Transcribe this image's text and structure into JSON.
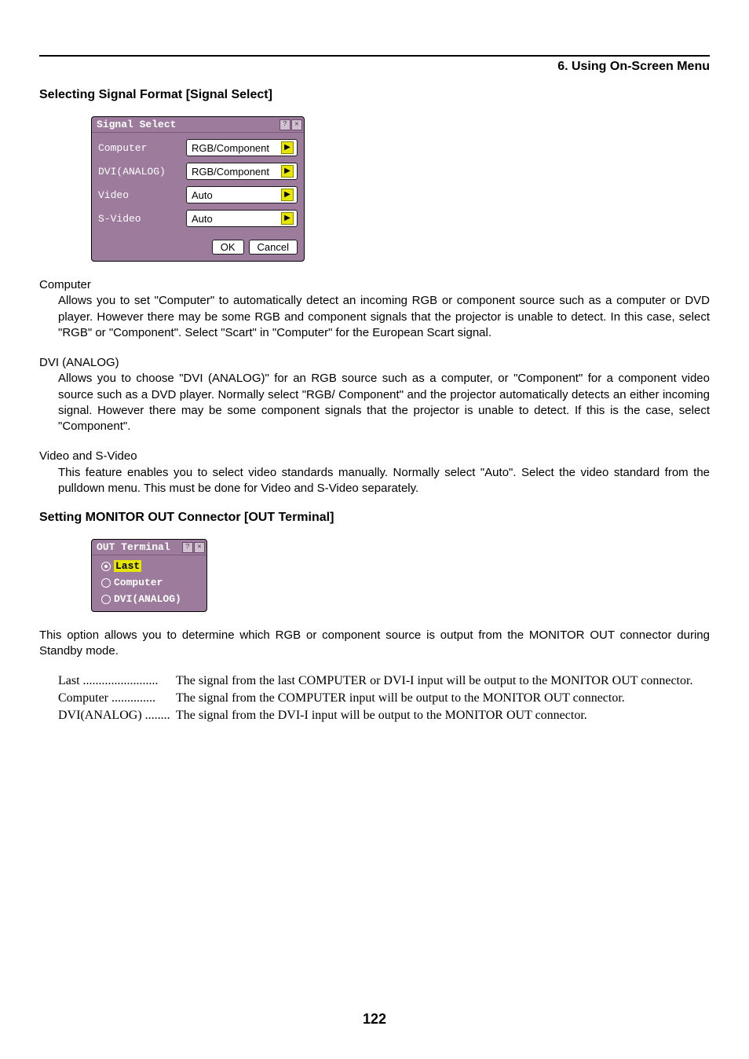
{
  "header": {
    "section_title": "6. Using On-Screen Menu"
  },
  "section1": {
    "heading": "Selecting Signal Format [Signal Select]",
    "dialog": {
      "title": "Signal Select",
      "rows": [
        {
          "label": "Computer",
          "value": "RGB/Component"
        },
        {
          "label": "DVI(ANALOG)",
          "value": "RGB/Component"
        },
        {
          "label": "Video",
          "value": "Auto"
        },
        {
          "label": "S-Video",
          "value": "Auto"
        }
      ],
      "ok": "OK",
      "cancel": "Cancel"
    },
    "computer": {
      "term": "Computer",
      "body": "Allows you to set \"Computer\" to automatically detect an incoming RGB or component source such as a computer or DVD player. However there may be some RGB and component signals that the projector is unable to detect. In this case, select \"RGB\" or \"Component\". Select \"Scart\" in \"Computer\" for the European Scart signal."
    },
    "dvi": {
      "term": "DVI (ANALOG)",
      "body": "Allows you to choose \"DVI (ANALOG)\" for an RGB source such as a computer, or \"Component\" for a component video source such as a DVD player. Normally select \"RGB/ Component\" and the projector automatically detects an either incoming signal. However there may be some component signals that the projector is unable to detect. If this is the case, select \"Component\"."
    },
    "video": {
      "term": "Video and S-Video",
      "body": "This feature enables you to select video standards manually. Normally select \"Auto\". Select the video standard from the pulldown menu. This must be done for Video and S-Video separately."
    }
  },
  "section2": {
    "heading": "Setting MONITOR OUT Connector [OUT Terminal]",
    "dialog": {
      "title": "OUT Terminal",
      "options": [
        {
          "label": "Last",
          "selected": true
        },
        {
          "label": "Computer",
          "selected": false
        },
        {
          "label": "DVI(ANALOG)",
          "selected": false
        }
      ]
    },
    "intro": "This option allows you to determine which RGB or component source is output from the MONITOR OUT connector during Standby mode.",
    "defs": [
      {
        "term": "Last ........................",
        "desc": "The signal from the last COMPUTER or DVI-I input will be output to the MONITOR OUT connector."
      },
      {
        "term": "Computer ..............",
        "desc": "The signal from the COMPUTER input will be output to the MONITOR OUT connector."
      },
      {
        "term": "DVI(ANALOG) ........",
        "desc": "The signal from the DVI-I input will be output to the MONITOR OUT connector."
      }
    ]
  },
  "page_number": "122"
}
